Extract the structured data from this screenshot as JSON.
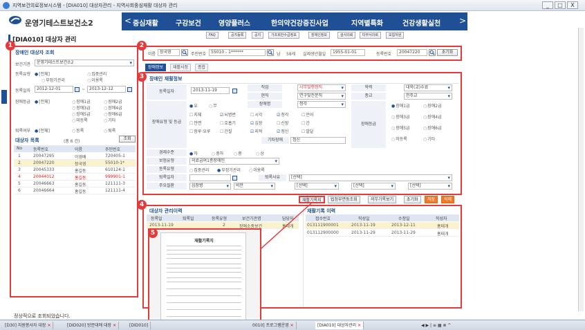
{
  "window": {
    "title": "지역보건의료정보시스템 - [DIA010] 대상자관리 - 지역사회중심재활 대상자 관리",
    "min": "_",
    "max": "□",
    "close": "X"
  },
  "brand": {
    "name": "운영기테스트보건소2"
  },
  "nav": {
    "items": [
      "중심재활",
      "구강보건",
      "영양플러스",
      "한의약건강증진사업",
      "지역별특화",
      "건강생활실천"
    ],
    "prev": "<",
    "next": ">"
  },
  "subnav": [
    "FAQ",
    "공지등록",
    "공지",
    "가조회한수급정보",
    "장애인정보",
    "검사의뢰",
    "타부서의뢰",
    "보험자원"
  ],
  "page_title": "[DIA010] 대상자 관리",
  "markers": [
    "1",
    "2",
    "3",
    "4",
    "5"
  ],
  "left": {
    "search_title": "장애인 대상자 조회",
    "center_label": "보건기관",
    "center_value": "운영기테스트보건소2",
    "reg_type_label": "등록유형",
    "reg_type_opts": [
      "[전체]",
      "집중관리",
      "부정기관리",
      "이용록"
    ],
    "reg_date_label": "등록일자",
    "date_from": "2012-12-01",
    "date_sep": "~",
    "date_to": "2013-12-12",
    "disability_label": "장애등급",
    "disability_opts": [
      "[전체]",
      "장애1급",
      "장애2급",
      "장애3급",
      "장애4급",
      "장애5급",
      "장애6급",
      "미등록",
      "기타"
    ],
    "exit_label": "퇴록여부",
    "exit_opts": [
      "[전체]",
      "등록",
      "퇴록"
    ],
    "list_title": "대상자 목록",
    "list_count": "(총  6  건)",
    "search_btn": "조회",
    "columns": [
      "No",
      "등록번호",
      "이름",
      "주민번호"
    ],
    "rows": [
      [
        "1",
        "20047295",
        "이영배",
        "720405-1"
      ],
      [
        "2",
        "20047220",
        "장국영",
        "55010-1*"
      ],
      [
        "3",
        "20045333",
        "홍길동",
        "610124-1"
      ],
      [
        "4",
        "20044012",
        "홍길동",
        "999901-1"
      ],
      [
        "5",
        "20046663",
        "홍길동",
        "121111-3"
      ],
      [
        "6",
        "20046664",
        "홍길동",
        "121111-4"
      ]
    ],
    "status": "정상적으로 조회되었습니다."
  },
  "header_bar": {
    "name_label": "이름",
    "name_value": "장국영",
    "ssn_label": "주민번호",
    "ssn_value": "55010 - 1******",
    "sex": "남",
    "age": "58세",
    "birth_label": "실제생년월일",
    "birth_value": "1955-01-01",
    "reg_label": "등록번호",
    "reg_value": "20047220",
    "reset_btn": "초기화"
  },
  "tabs": [
    "장애정보",
    "재활사정",
    "종합"
  ],
  "detail": {
    "section_title": "장애인 재활정보",
    "reg_date_label": "등록일자",
    "reg_date": "2013-11-19",
    "job_label": "직업",
    "job_value": "사무및행정직",
    "edu_label": "학력",
    "edu_value": "대학(교)수료",
    "status_label": "현직",
    "status_value": "연구및전문직",
    "religion_label": "종교",
    "religion_value": "천주교",
    "presence": [
      "유",
      "무"
    ],
    "disab_type_label": "장애유형 및 등급",
    "disab_name_label": "장애명",
    "disab_name_value": "청각",
    "types": [
      "지체",
      "뇌병변",
      "시각",
      "청각",
      "언어",
      "안면",
      "호흡기",
      "심장",
      "신장",
      "간",
      "장루·요루",
      "간질",
      "지적",
      "정신",
      "발달"
    ],
    "types_on": [
      false,
      true,
      false,
      true,
      false,
      false,
      false,
      true,
      false,
      false,
      false,
      false,
      true,
      true,
      false
    ],
    "other_disab_label": "기타장애",
    "other_disab_value": "정신",
    "grade_label": "장애등급",
    "grades": [
      "장애1급",
      "장애2급",
      "장애3급",
      "장애4급",
      "장애5급",
      "장애6급",
      "미등록",
      "기타"
    ],
    "econ_label": "경제수준",
    "econ_opts": [
      "하",
      "중하",
      "중",
      "상"
    ],
    "insurance_label": "보험유형",
    "insurance_value": "의료급여1종장애인",
    "regtype_label": "등록유형",
    "regtype_opts": [
      "집중관리",
      "부정기관리",
      "이용록"
    ],
    "exit_date_label": "퇴록일자",
    "exit_reason_label": "퇴록사유",
    "exit_reason_value": "[선택]",
    "main_disease_label": "주요질환",
    "main_disease_values": [
      "심장병",
      "비만",
      "[선택]",
      "[선택]",
      "[선택]"
    ]
  },
  "actions": [
    "재활기록지",
    "법정부면동조회",
    "의무기록보기",
    "초기화",
    "저장",
    "삭제"
  ],
  "history": {
    "title": "대상자 관리이력",
    "columns": [
      "등록일",
      "퇴록일",
      "등록유형",
      "보건기관명",
      "담당자"
    ],
    "row": [
      "2013-11-19",
      "",
      "2",
      "장애소중보건",
      "홍대개"
    ]
  },
  "rehab": {
    "title": "재활기록 이력",
    "columns": [
      "접수번호",
      "작성일",
      "수정일",
      "작성자"
    ],
    "rows": [
      [
        "013111900001",
        "2013-11-19",
        "2013-12-11",
        "홍태개"
      ],
      [
        "013112900000",
        "2013-11-29",
        "2013-11-29",
        "홍태개"
      ]
    ]
  },
  "doc_preview": {
    "title": "재활기록지"
  },
  "taskbar": {
    "tabs": [
      "[D30] 지원봉사자 대장",
      "[DID020] 방문대에 대장",
      "[DID010]",
      "0010] 프로그램운영",
      "[DIA010] 대상자관리"
    ]
  }
}
